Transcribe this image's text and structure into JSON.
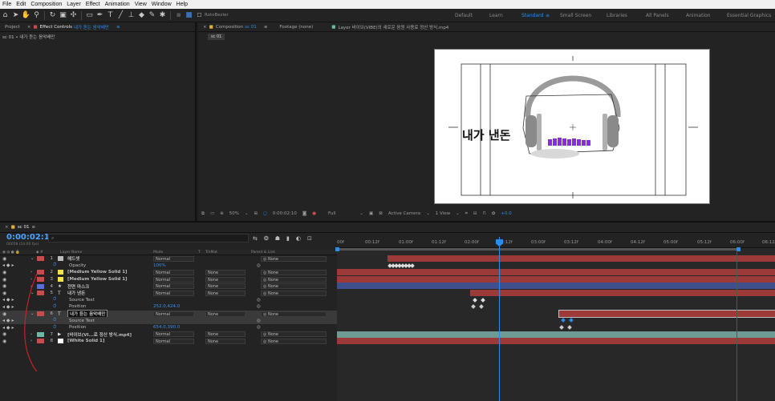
{
  "menu": [
    "File",
    "Edit",
    "Composition",
    "Layer",
    "Effect",
    "Animation",
    "View",
    "Window",
    "Help"
  ],
  "toolbar": {
    "rotobezier_label": "RotoBezier",
    "workspaces": [
      "Default",
      "Learn",
      "Standard",
      "Small Screen",
      "Libraries",
      "All Panels",
      "Animation",
      "Essential Graphics"
    ],
    "active_workspace": "Standard"
  },
  "left_panel": {
    "tab_project": "Project",
    "tab_effect_controls": "Effect Controls",
    "effect_controls_layer": "내가 듣는 음악배만",
    "breadcrumb": "sc 01 • 내가 듣는 음악배만"
  },
  "comp_panel": {
    "tab_composition": "Composition",
    "comp_name": "sc 01",
    "tab_footage": "Footage (none)",
    "tab_layer": "Layer 바이브(VIBE)의 새로운 음원 사용료 정산 방식.mp4",
    "comp_subtab": "sc 01",
    "canvas_text": "내가 낸돈"
  },
  "comp_footer": {
    "zoom": "50%",
    "timecode": "0:00:02:10",
    "resolution": "Full",
    "camera": "Active Camera",
    "view": "1 View",
    "exposure": "+0.0"
  },
  "timeline": {
    "tab": "sc 01",
    "timecode": "0:00:02:10",
    "fps_info": "00058 (24.00 fps)",
    "search_placeholder": "",
    "column_headers": {
      "layer_name": "Layer Name",
      "mode": "Mode",
      "t": "T",
      "trkmat": "TrkMat",
      "parent": "Parent & Link"
    },
    "ruler_ticks": [
      "00f",
      "00:12f",
      "01:00f",
      "01:12f",
      "02:00f",
      "02:12f",
      "03:00f",
      "03:12f",
      "04:00f",
      "04:12f",
      "05:00f",
      "05:12f",
      "06:00f",
      "06:12f"
    ],
    "rows": [
      {
        "num": "1",
        "name": "헤드셋",
        "mode": "Normal",
        "trk": "",
        "parent": "None",
        "label_color": "#c84c4c",
        "kind": "layer"
      },
      {
        "num": "",
        "name": "Opacity",
        "value": "100%",
        "kind": "prop"
      },
      {
        "num": "2",
        "name": "[Medium Yellow Solid 1]",
        "mode": "Normal",
        "trk": "None",
        "parent": "None",
        "label_color": "#c84c4c",
        "kind": "layer"
      },
      {
        "num": "3",
        "name": "[Medium Yellow Solid 1]",
        "mode": "Normal",
        "trk": "None",
        "parent": "None",
        "label_color": "#c84c4c",
        "kind": "layer"
      },
      {
        "num": "4",
        "name": "전면 마스크",
        "mode": "Normal",
        "trk": "None",
        "parent": "None",
        "label_color": "#5a6ed4",
        "kind": "layer"
      },
      {
        "num": "5",
        "name": "내가 낸돈",
        "mode": "Normal",
        "trk": "None",
        "parent": "None",
        "label_color": "#c84c4c",
        "kind": "layer"
      },
      {
        "num": "",
        "name": "Source Text",
        "value": "",
        "kind": "prop"
      },
      {
        "num": "",
        "name": "Position",
        "value": "252.0,424.0",
        "kind": "prop"
      },
      {
        "num": "6",
        "name": "내가 듣는 음악배만",
        "mode": "Normal",
        "trk": "None",
        "parent": "None",
        "label_color": "#c84c4c",
        "kind": "layer",
        "selected": true
      },
      {
        "num": "",
        "name": "Source Text",
        "value": "",
        "kind": "prop",
        "selected": true
      },
      {
        "num": "",
        "name": "Position",
        "value": "654.0,390.0",
        "kind": "prop"
      },
      {
        "num": "7",
        "name": "[바이브(VI...료 정산 방식.mp4]",
        "mode": "Normal",
        "trk": "None",
        "parent": "None",
        "label_color": "#6fb7a6",
        "kind": "layer"
      },
      {
        "num": "8",
        "name": "[White Solid 1]",
        "mode": "Normal",
        "trk": "None",
        "parent": "None",
        "label_color": "#c84c4c",
        "kind": "layer"
      }
    ]
  },
  "colors": {
    "accent_blue": "#2d8ceb",
    "track_red": "#9c3a3a",
    "track_blue": "#3e4f8c",
    "track_teal": "#6f9a93",
    "canvas_bg": "#ffffff",
    "bar_purple": "#8a2be2"
  }
}
